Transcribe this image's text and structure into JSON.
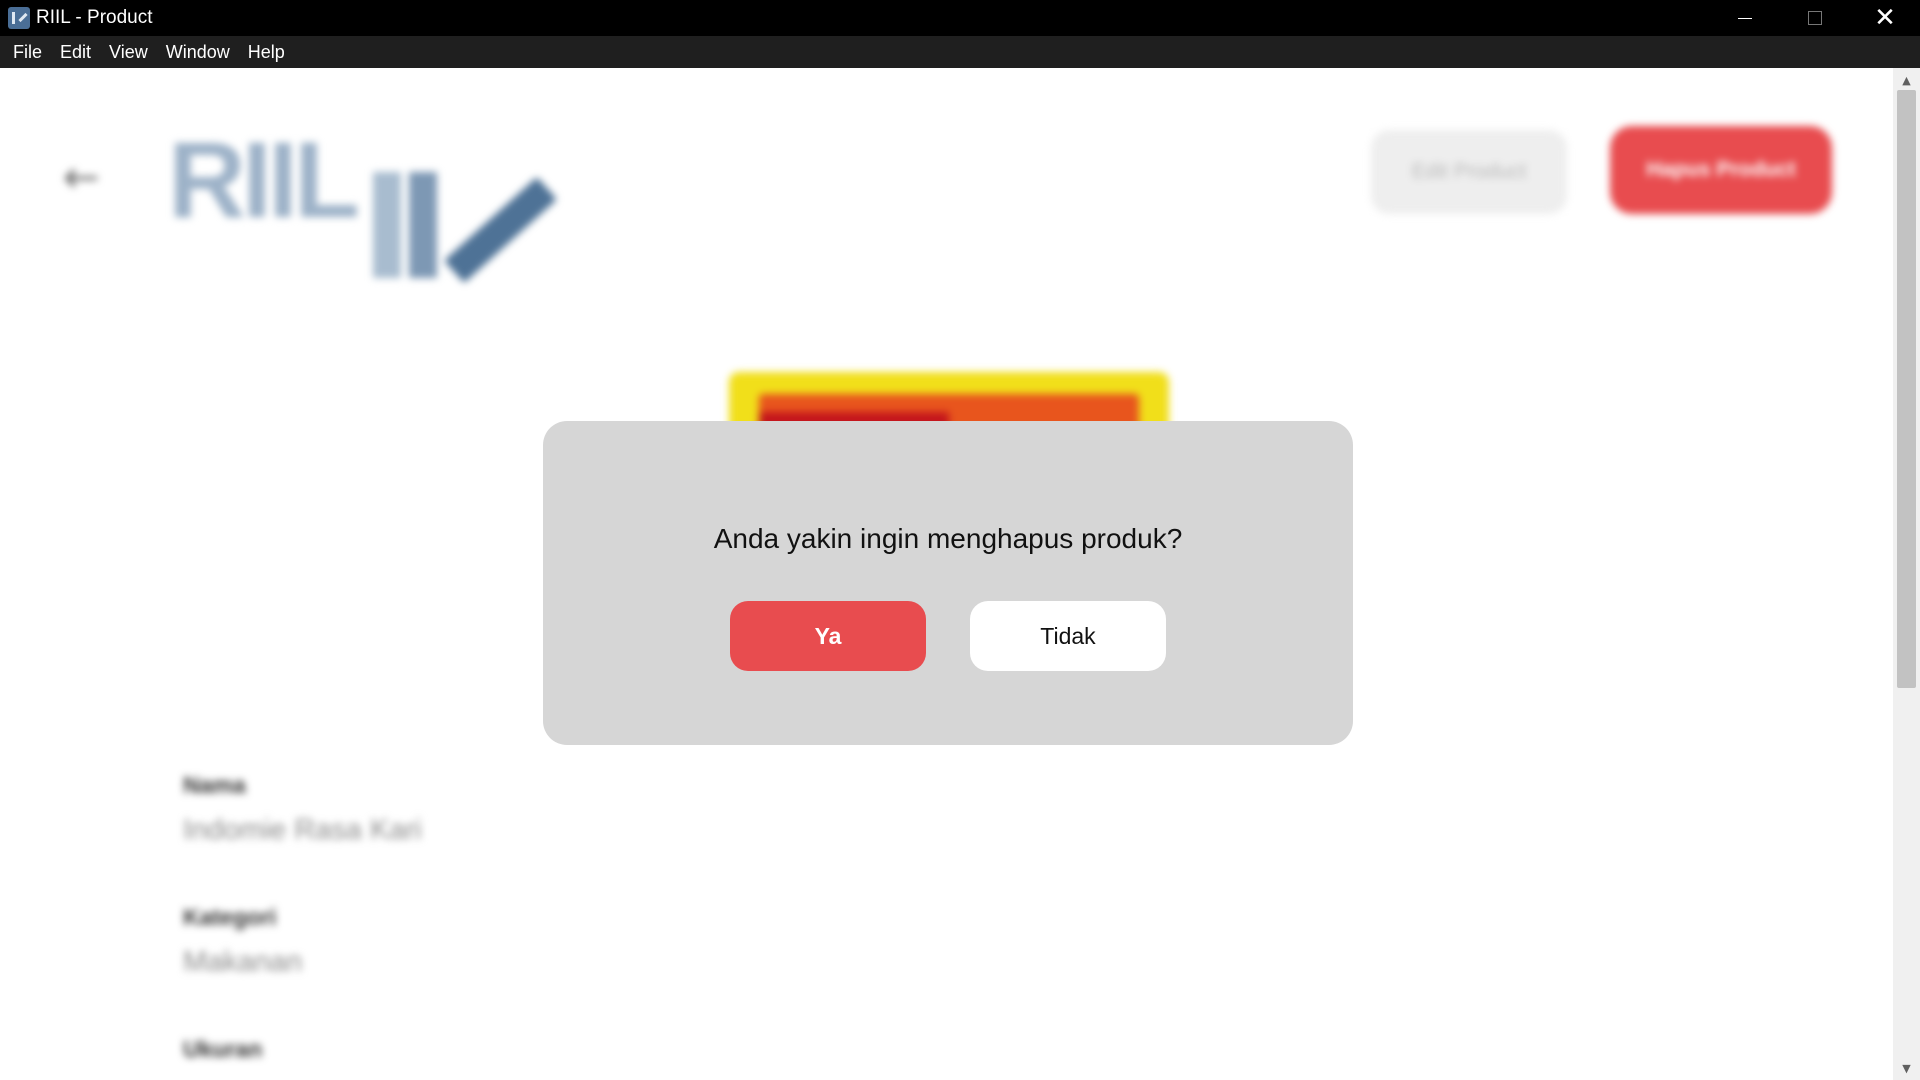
{
  "window": {
    "title": "RIIL - Product",
    "controls": {
      "minimize": "minimize-icon",
      "maximize": "maximize-icon",
      "close": "✕"
    }
  },
  "menu": {
    "items": [
      "File",
      "Edit",
      "View",
      "Window",
      "Help"
    ]
  },
  "header": {
    "back_icon": "arrow-left-icon",
    "logo_text": "RIIL",
    "edit_button_label": "Edit Product",
    "delete_button_label": "Hapus Product"
  },
  "product": {
    "fields": [
      {
        "label": "Nama",
        "value": "Indomie Rasa Kari"
      },
      {
        "label": "Kategori",
        "value": "Makanan"
      },
      {
        "label": "Ukuran",
        "value": ""
      }
    ]
  },
  "dialog": {
    "message": "Anda yakin ingin menghapus produk?",
    "confirm_label": "Ya",
    "cancel_label": "Tidak"
  },
  "colors": {
    "accent_red": "#e84c4f",
    "dialog_bg": "#d6d6d6",
    "logo_blue": "#4e7296"
  }
}
